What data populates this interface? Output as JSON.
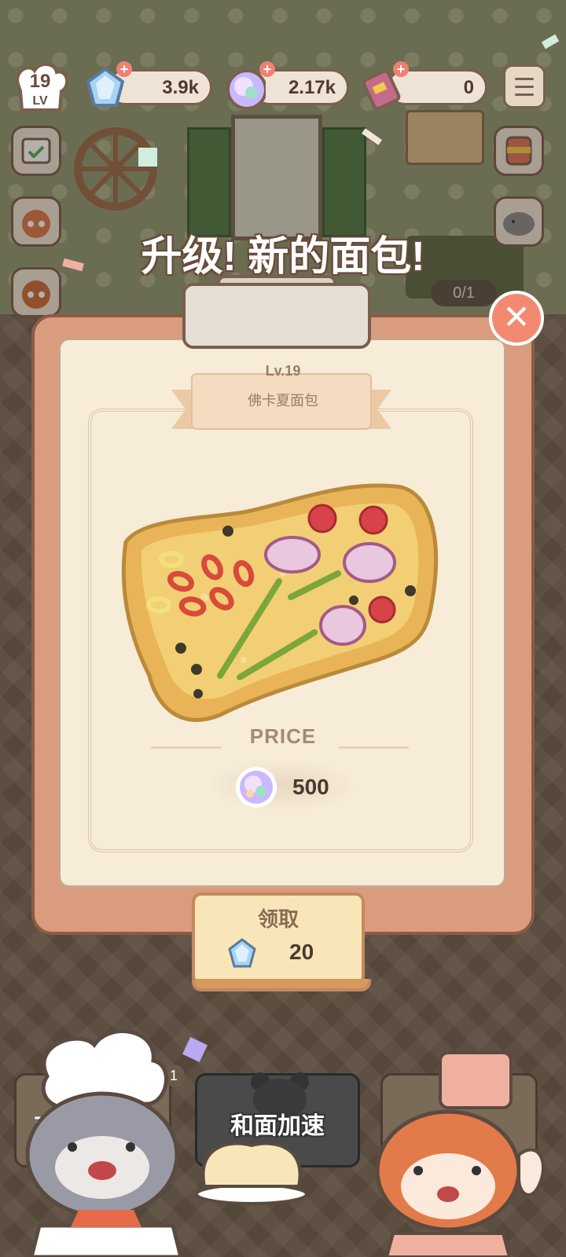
{
  "hud": {
    "level_number": "19",
    "level_label": "LV",
    "gems": "3.9k",
    "coins": "2.17k",
    "tickets": "0",
    "gems_plus": "+",
    "coins_plus": "+",
    "tickets_plus": "+"
  },
  "scene": {
    "counter_progress": "0/1"
  },
  "popup": {
    "title": "升级! 新的面包!",
    "bread_level": "Lv.19",
    "bread_name": "佛卡夏面包",
    "price_label": "PRICE",
    "price_value": "500",
    "claim_label": "领取",
    "claim_value": "20",
    "close_symbol": "✕"
  },
  "bottom": {
    "speed_label": "和面加速",
    "shop_badge": "1",
    "shop_label_fragment": "商"
  },
  "colors": {
    "accent_red": "#f28a72",
    "card": "#f6ecd8",
    "frame": "#d99c7e",
    "text_dark": "#4a3a30"
  }
}
